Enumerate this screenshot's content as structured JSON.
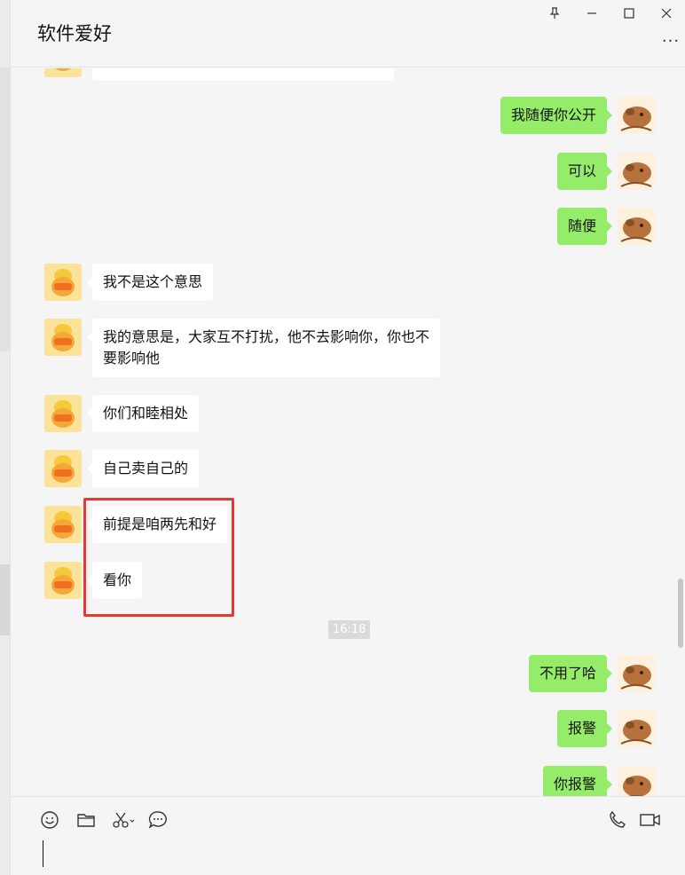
{
  "window": {
    "title": "软件爱好",
    "controls": [
      "pin-icon",
      "minimize-icon",
      "maximize-icon",
      "close-icon"
    ],
    "more_label": "···"
  },
  "colors": {
    "self_bubble": "#95ec69",
    "other_bubble": "#ffffff",
    "highlight": "#e53935",
    "background": "#f5f5f5"
  },
  "messages": [
    {
      "side": "self",
      "text": "我随便你公开"
    },
    {
      "side": "self",
      "text": "可以"
    },
    {
      "side": "self",
      "text": "随便"
    },
    {
      "side": "other",
      "text": "我不是这个意思"
    },
    {
      "side": "other",
      "text": "我的意思是，大家互不打扰，他不去影响你，你也不要影响他"
    },
    {
      "side": "other",
      "text": "你们和睦相处"
    },
    {
      "side": "other",
      "text": "自己卖自己的"
    },
    {
      "side": "other",
      "text": "前提是咱两先和好"
    },
    {
      "side": "other",
      "text": "看你"
    },
    {
      "side": "time",
      "text": "16:18"
    },
    {
      "side": "self",
      "text": "不用了哈"
    },
    {
      "side": "self",
      "text": "报警"
    },
    {
      "side": "self",
      "text": "你报警"
    }
  ],
  "toolbar": {
    "left": [
      "emoji-icon",
      "folder-icon",
      "scissors-icon",
      "chat-history-icon"
    ],
    "right": [
      "phone-icon",
      "video-icon"
    ]
  }
}
